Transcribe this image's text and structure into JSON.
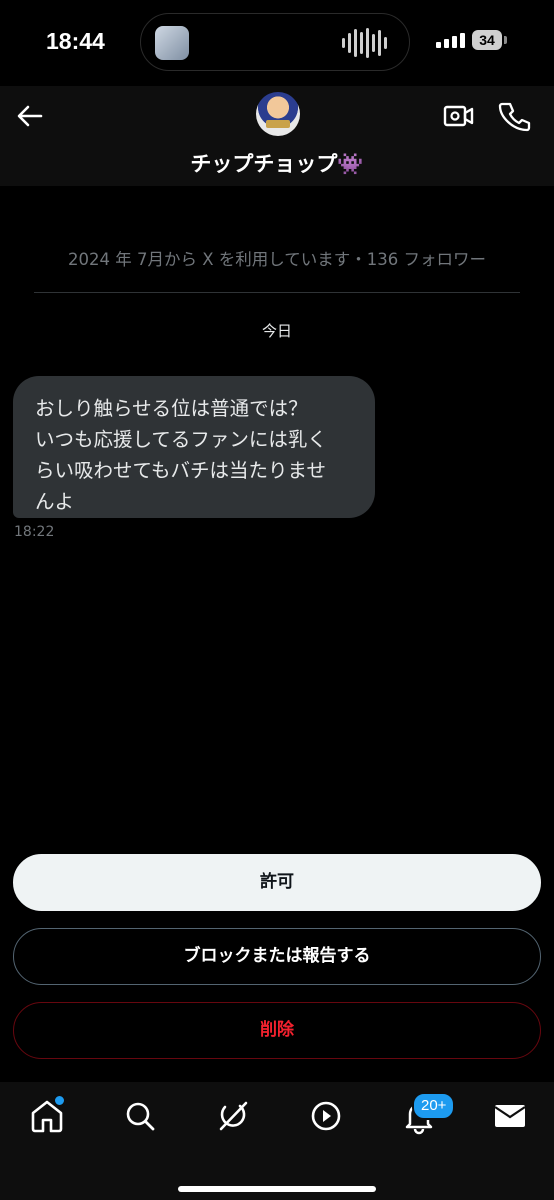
{
  "status_bar": {
    "time": "18:44",
    "battery": "34"
  },
  "header": {
    "contact_name": "チップチョップ👾"
  },
  "conversation": {
    "join_info": "2024 年 7月から X を利用しています・136 フォロワー",
    "day_label": "今日",
    "messages": [
      {
        "text": "おしり触らせる位は普通では？\nいつも応援してるファンには乳く\nらい吸わせてもバチは当たりませ\nんよ",
        "time": "18:22"
      }
    ]
  },
  "actions": {
    "allow": "許可",
    "block_report": "ブロックまたは報告する",
    "delete": "削除"
  },
  "tabbar": {
    "notification_badge": "20+"
  },
  "colors": {
    "accent": "#1d9bf0",
    "danger": "#f4212e",
    "bubble": "#2f3336"
  }
}
